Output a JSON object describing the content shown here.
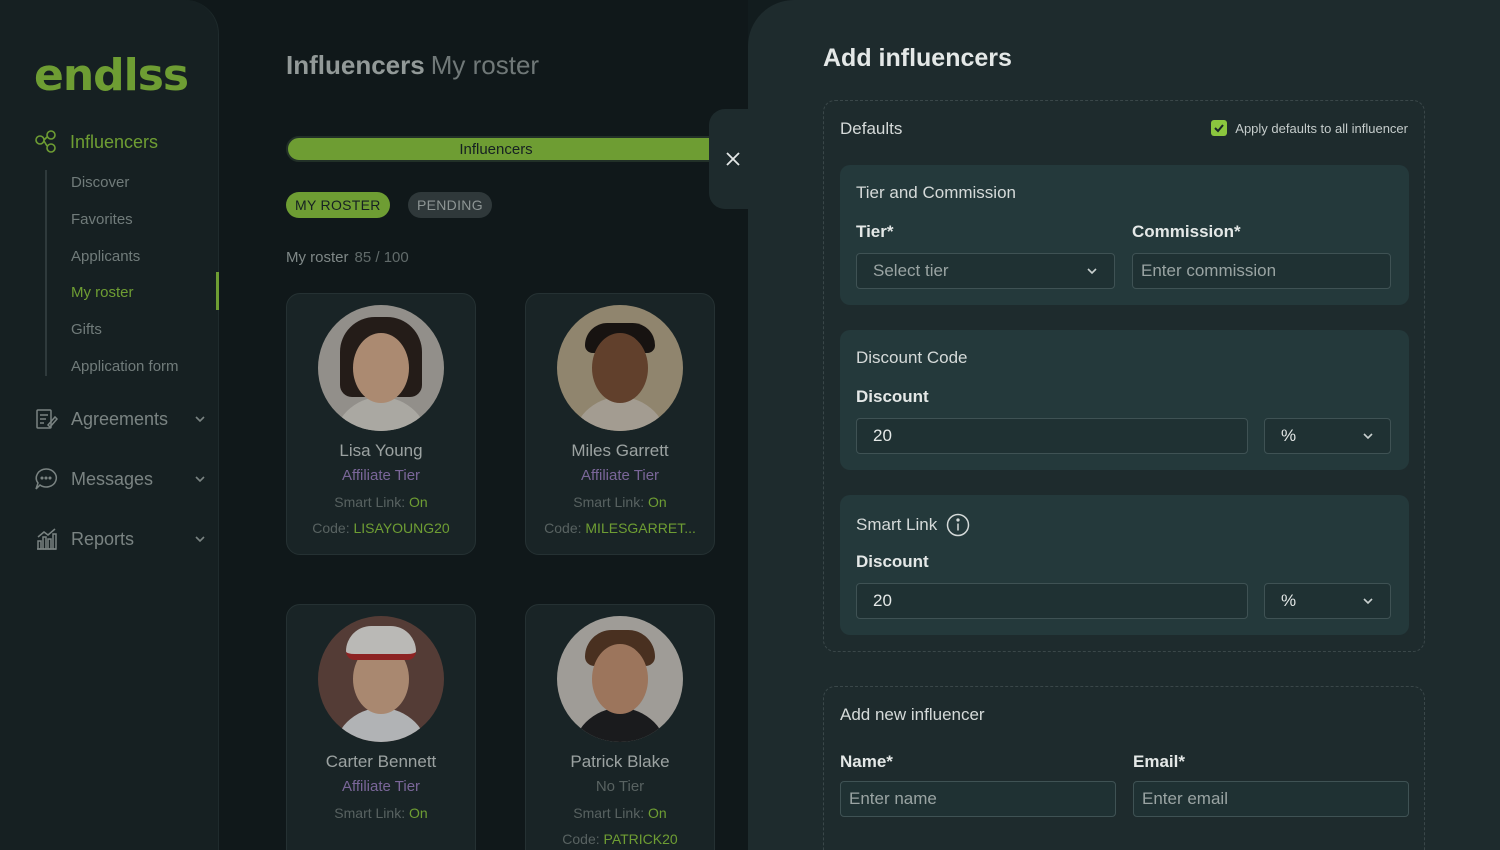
{
  "app": {
    "logo": "endlss"
  },
  "sidebar": {
    "main_label": "Influencers",
    "sub_items": [
      "Discover",
      "Favorites",
      "Applicants",
      "My roster",
      "Gifts",
      "Application form"
    ],
    "groups": [
      "Agreements",
      "Messages",
      "Reports"
    ]
  },
  "main": {
    "title": "Influencers",
    "subtitle": "My roster",
    "progress_label": "Influencers",
    "progress_fraction": 0.85,
    "tabs": [
      "MY ROSTER",
      "PENDING"
    ],
    "roster_label": "My roster",
    "roster_count": "85 / 100",
    "smart_link_label": "Smart Link:",
    "code_label": "Code:",
    "cards": [
      {
        "name": "Lisa Young",
        "tier": "Affiliate Tier",
        "smart_link": "On",
        "code": "LISAYOUNG20"
      },
      {
        "name": "Miles Garrett",
        "tier": "Affiliate Tier",
        "smart_link": "On",
        "code": "MILESGARRET..."
      },
      {
        "name": "Carter Bennett",
        "tier": "Affiliate Tier",
        "smart_link": "On",
        "code": ""
      },
      {
        "name": "Patrick Blake",
        "tier": "No Tier",
        "smart_link": "On",
        "code": "PATRICK20"
      }
    ]
  },
  "panel": {
    "title": "Add influencers",
    "defaults": {
      "heading": "Defaults",
      "apply_label": "Apply defaults to all influencer",
      "tier_section": {
        "heading": "Tier and Commission",
        "tier_label": "Tier*",
        "tier_placeholder": "Select tier",
        "commission_label": "Commission*",
        "commission_placeholder": "Enter commission"
      },
      "discount_section": {
        "heading": "Discount Code",
        "label": "Discount",
        "value": "20",
        "unit": "%"
      },
      "smart_link_section": {
        "heading": "Smart Link",
        "label": "Discount",
        "value": "20",
        "unit": "%"
      }
    },
    "new_influencer": {
      "heading": "Add new influencer",
      "name_label": "Name*",
      "name_placeholder": "Enter name",
      "email_label": "Email*",
      "email_placeholder": "Enter email"
    }
  },
  "colors": {
    "accent": "#8bc63e",
    "tier": "#9a7fc0",
    "background": "#121c1e"
  }
}
